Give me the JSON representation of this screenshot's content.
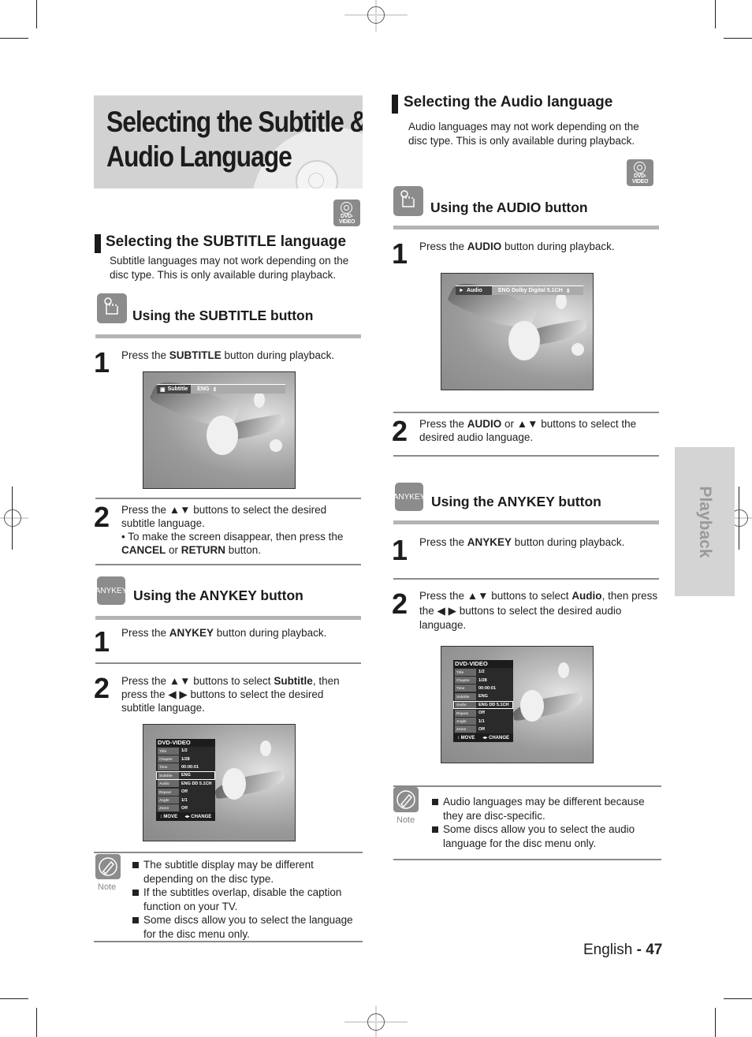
{
  "page": {
    "title_line1": "Selecting the Subtitle &",
    "title_line2": "Audio Language",
    "side_tab": "Playback",
    "footer_language": "English",
    "footer_separator": " - ",
    "footer_page": "47"
  },
  "badges": {
    "dvd_video": "DVD-VIDEO",
    "anykey": "ANYKEY",
    "note": "Note"
  },
  "subtitle_section": {
    "heading": "Selecting the SUBTITLE language",
    "intro": "Subtitle languages may not work depending on the disc type. This is only available during playback.",
    "subtitle_button": {
      "heading": "Using the SUBTITLE button",
      "step1": {
        "num": "1",
        "pre": "Press the ",
        "bold": "SUBTITLE",
        "post": " button during playback."
      },
      "osd": {
        "label": "Subtitle",
        "value": "ENG"
      },
      "step2": {
        "num": "2",
        "text": "Press the ▲▼ buttons to select the desired subtitle language.",
        "bullet_pre": "• To make the screen disappear, then press the ",
        "bold1": "CANCEL",
        "mid": " or ",
        "bold2": "RETURN",
        "post": " button."
      }
    },
    "anykey_button": {
      "heading": "Using the ANYKEY button",
      "step1": {
        "num": "1",
        "pre": "Press the ",
        "bold": "ANYKEY",
        "post": " button during playback."
      },
      "step2": {
        "num": "2",
        "pre": "Press the ▲▼ buttons to select ",
        "bold": "Subtitle",
        "post": ", then press the ◀ ▶ buttons to select the desired subtitle language."
      }
    },
    "notes": [
      "The subtitle display may be different depending on the disc type.",
      "If the subtitles overlap, disable the caption function on your TV.",
      "Some discs allow you to select the language for the disc menu only."
    ]
  },
  "audio_section": {
    "heading": "Selecting the Audio language",
    "intro": "Audio languages may not work depending on the disc type. This is only available during playback.",
    "audio_button": {
      "heading": "Using the AUDIO button",
      "step1": {
        "num": "1",
        "pre": "Press the ",
        "bold": "AUDIO",
        "post": " button during playback."
      },
      "osd": {
        "label": "Audio",
        "value": "ENG Dolby Digital 5.1CH"
      },
      "step2": {
        "num": "2",
        "pre": "Press the ",
        "bold": "AUDIO",
        "post": " or ▲▼ buttons to select the desired audio language."
      }
    },
    "anykey_button": {
      "heading": "Using the ANYKEY button",
      "step1": {
        "num": "1",
        "pre": "Press the ",
        "bold": "ANYKEY",
        "post": " button during playback."
      },
      "step2": {
        "num": "2",
        "pre": "Press the ▲▼ buttons to select ",
        "bold": "Audio",
        "post": ", then press the ◀ ▶ buttons to select the desired audio language."
      }
    },
    "notes": [
      "Audio languages may be different because they are disc-specific.",
      "Some discs allow you to select the audio language for the disc menu only."
    ]
  },
  "dvd_menu": {
    "header": "DVD-VIDEO",
    "rows": [
      {
        "key": "Title",
        "value": "1/2"
      },
      {
        "key": "Chapter",
        "value": "1/28"
      },
      {
        "key": "Time",
        "value": "00:00:01"
      },
      {
        "key": "Subtitle",
        "value": "ENG"
      },
      {
        "key": "Audio",
        "value": "ENG DD 5.1CH"
      },
      {
        "key": "Repeat",
        "value": "Off"
      },
      {
        "key": "Angle",
        "value": "1/1"
      },
      {
        "key": "Zoom",
        "value": "Off"
      }
    ],
    "footer_move": "↕ MOVE",
    "footer_change": "◂▸ CHANGE"
  }
}
